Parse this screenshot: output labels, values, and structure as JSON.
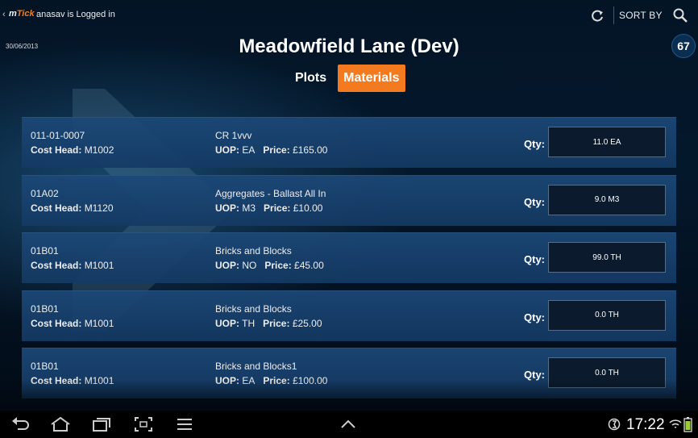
{
  "header": {
    "logo_prefix": "m",
    "logo_accent": "Tick",
    "logged_in": "anasav is Logged in",
    "date": "30/06/2013",
    "sort_label": "SORT BY",
    "count": "67",
    "accent_color": "#f47a1f"
  },
  "page_title": "Meadowfield Lane (Dev)",
  "tabs": [
    {
      "label": "Plots",
      "active": false
    },
    {
      "label": "Materials",
      "active": true
    }
  ],
  "labels": {
    "cost_head": "Cost Head:",
    "uop": "UOP:",
    "price": "Price:",
    "qty": "Qty:"
  },
  "rows": [
    {
      "code": "011-01-0007",
      "cost_head": "M1002",
      "description": "CR 1vvv",
      "uop": "EA",
      "price": "£165.00",
      "qty": "11.0 EA"
    },
    {
      "code": "01A02",
      "cost_head": "M1120",
      "description": "Aggregates - Ballast All In",
      "uop": "M3",
      "price": "£10.00",
      "qty": "9.0 M3"
    },
    {
      "code": "01B01",
      "cost_head": "M1001",
      "description": "Bricks and Blocks",
      "uop": "NO",
      "price": "£45.00",
      "qty": "99.0 TH"
    },
    {
      "code": "01B01",
      "cost_head": "M1001",
      "description": "Bricks and Blocks",
      "uop": "TH",
      "price": "£25.00",
      "qty": "0.0 TH"
    },
    {
      "code": "01B01",
      "cost_head": "M1001",
      "description": "Bricks and Blocks1",
      "uop": "EA",
      "price": "£100.00",
      "qty": "0.0 TH"
    }
  ],
  "system": {
    "time": "17:22",
    "icons": [
      "back-icon",
      "home-icon",
      "recent-apps-icon",
      "screenshot-icon",
      "menu-icon",
      "up-chevron-icon",
      "status-icon",
      "wifi-icon",
      "battery-icon"
    ]
  }
}
